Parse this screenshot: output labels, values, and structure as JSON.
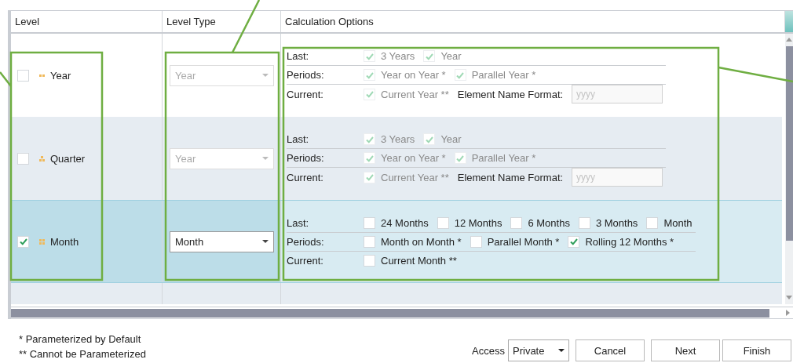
{
  "columns": [
    "Level",
    "Level Type",
    "Calculation Options"
  ],
  "rows": [
    {
      "selected": false,
      "level": {
        "name": "Year",
        "checked": false,
        "kind": "pair"
      },
      "level_type": {
        "value": "Year",
        "disabled": true
      },
      "sections": [
        {
          "label": "Last:",
          "items": [
            {
              "text": "3 Years",
              "checked": true,
              "disabled": true
            },
            {
              "text": "Year",
              "checked": true,
              "disabled": true
            }
          ]
        },
        {
          "label": "Periods:",
          "items": [
            {
              "text": "Year on Year *",
              "checked": true,
              "disabled": true
            },
            {
              "text": "Parallel Year *",
              "checked": true,
              "disabled": true
            }
          ]
        },
        {
          "label": "Current:",
          "items": [
            {
              "text": "Current Year **",
              "checked": true,
              "disabled": true
            }
          ],
          "format": {
            "label": "Element Name Format:",
            "placeholder": "yyyy"
          }
        }
      ]
    },
    {
      "selected": false,
      "level": {
        "name": "Quarter",
        "checked": false,
        "kind": "triad"
      },
      "level_type": {
        "value": "Year",
        "disabled": true
      },
      "sections": [
        {
          "label": "Last:",
          "items": [
            {
              "text": "3 Years",
              "checked": true,
              "disabled": true
            },
            {
              "text": "Year",
              "checked": true,
              "disabled": true
            }
          ]
        },
        {
          "label": "Periods:",
          "items": [
            {
              "text": "Year on Year *",
              "checked": true,
              "disabled": true
            },
            {
              "text": "Parallel Year *",
              "checked": true,
              "disabled": true
            }
          ]
        },
        {
          "label": "Current:",
          "items": [
            {
              "text": "Current Year **",
              "checked": true,
              "disabled": true
            }
          ],
          "format": {
            "label": "Element Name Format:",
            "placeholder": "yyyy"
          }
        }
      ]
    },
    {
      "selected": true,
      "level": {
        "name": "Month",
        "checked": true,
        "kind": "grid"
      },
      "level_type": {
        "value": "Month",
        "disabled": false
      },
      "sections": [
        {
          "label": "Last:",
          "items": [
            {
              "text": "24 Months",
              "checked": false,
              "disabled": false
            },
            {
              "text": "12 Months",
              "checked": false,
              "disabled": false
            },
            {
              "text": "6 Months",
              "checked": false,
              "disabled": false
            },
            {
              "text": "3 Months",
              "checked": false,
              "disabled": false
            },
            {
              "text": "Month",
              "checked": false,
              "disabled": false
            }
          ]
        },
        {
          "label": "Periods:",
          "items": [
            {
              "text": "Month on Month *",
              "checked": false,
              "disabled": false
            },
            {
              "text": "Parallel Month *",
              "checked": false,
              "disabled": false
            },
            {
              "text": "Rolling 12 Months *",
              "checked": true,
              "disabled": false
            }
          ]
        },
        {
          "label": "Current:",
          "items": [
            {
              "text": "Current Month **",
              "checked": false,
              "disabled": false
            }
          ]
        }
      ]
    }
  ],
  "notes": [
    "* Parameterized by Default",
    "** Cannot be Parameterized"
  ],
  "access": {
    "label": "Access",
    "value": "Private"
  },
  "buttons": [
    "Cancel",
    "Next",
    "Finish"
  ]
}
